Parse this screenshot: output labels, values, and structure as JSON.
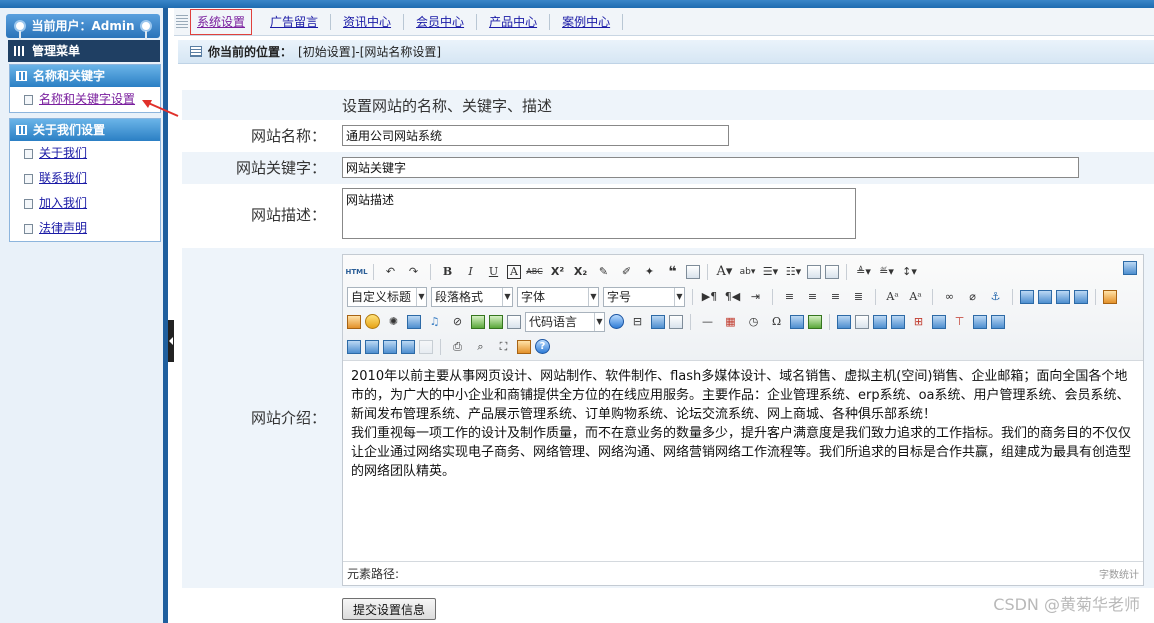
{
  "sidebar": {
    "user_label": "当前用户：Admin",
    "menu_title": "管理菜单",
    "groups": [
      {
        "title": "名称和关键字",
        "items": [
          {
            "label": "名称和关键字设置"
          }
        ]
      },
      {
        "title": "关于我们设置",
        "items": [
          {
            "label": "关于我们"
          },
          {
            "label": "联系我们"
          },
          {
            "label": "加入我们"
          },
          {
            "label": "法律声明"
          }
        ]
      }
    ]
  },
  "topnav": {
    "tabs": [
      {
        "label": "系统设置"
      },
      {
        "label": "广告留言"
      },
      {
        "label": "资讯中心"
      },
      {
        "label": "会员中心"
      },
      {
        "label": "产品中心"
      },
      {
        "label": "案例中心"
      }
    ]
  },
  "breadcrumb": {
    "prefix": "你当前的位置：",
    "path": "[初始设置]-[网站名称设置]"
  },
  "form": {
    "heading": "设置网站的名称、关键字、描述",
    "site_name_label": "网站名称：",
    "site_name_value": "通用公司网站系统",
    "keywords_label": "网站关键字：",
    "keywords_value": "网站关键字",
    "description_label": "网站描述：",
    "description_value": "网站描述",
    "intro_label": "网站介绍：",
    "submit_label": "提交设置信息"
  },
  "editor": {
    "toolbar": {
      "html_btn": "HTML",
      "custom_title": "自定义标题",
      "paragraph_format": "段落格式",
      "font_family": "字体",
      "font_size": "字号",
      "code_language": "代码语言"
    },
    "content": [
      "2010年以前主要从事网页设计、网站制作、软件制作、flash多媒体设计、域名销售、虚拟主机(空间)销售、企业邮箱；面向全国各个地市的，为广大的中小企业和商铺提供全方位的在线应用服务。主要作品：企业管理系统、erp系统、oa系统、用户管理系统、会员系统、新闻发布管理系统、产品展示管理系统、订单购物系统、论坛交流系统、网上商城、各种俱乐部系统！",
      "我们重视每一项工作的设计及制作质量，而不在意业务的数量多少，提升客户满意度是我们致力追求的工作指标。我们的商务目的不仅仅让企业通过网络实现电子商务、网络管理、网络沟通、网络营销网络工作流程等。我们所追求的目标是合作共赢，组建成为最具有创造型的网络团队精英。"
    ],
    "path_label": "元素路径:",
    "word_count_label": "字数统计"
  },
  "watermark": "CSDN @黄菊华老师"
}
